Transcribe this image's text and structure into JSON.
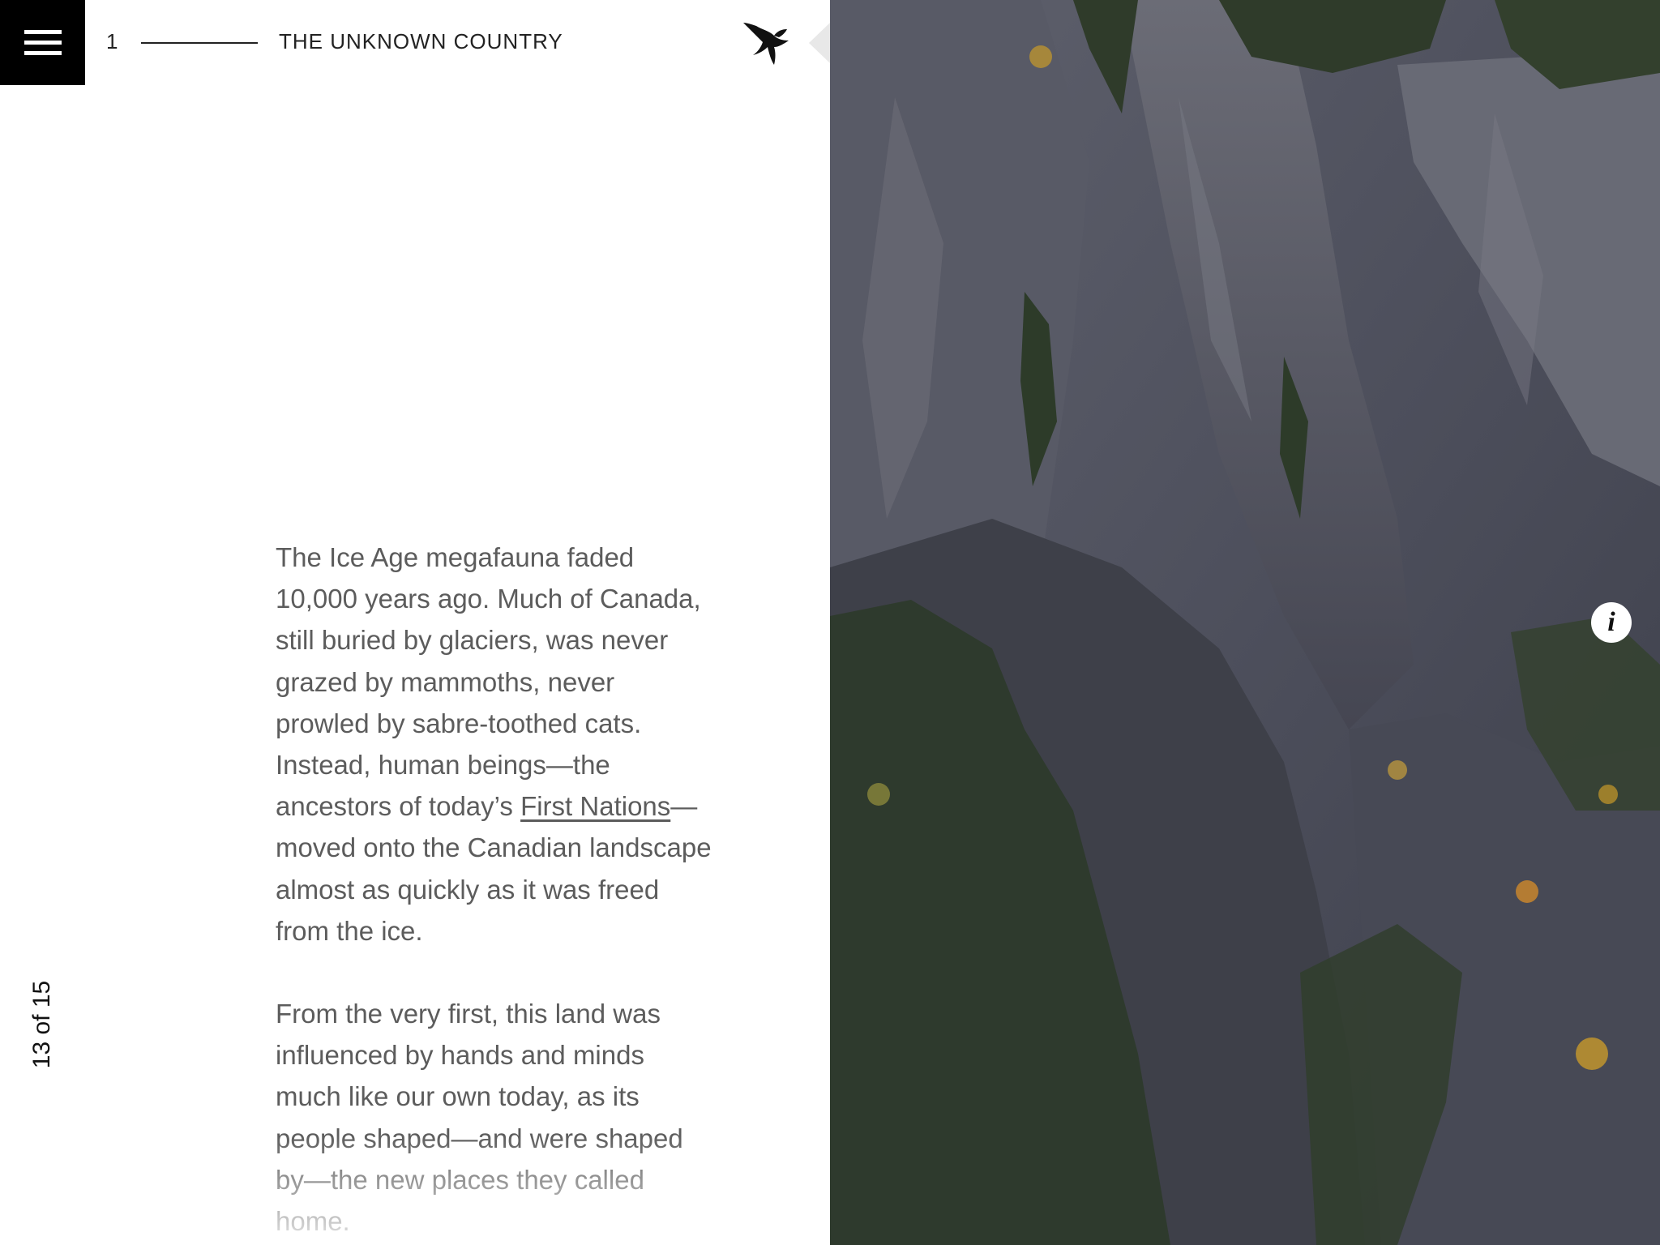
{
  "header": {
    "chapter_number": "1",
    "chapter_title": "THE UNKNOWN COUNTRY"
  },
  "icons": {
    "menu": "hamburger-menu-icon",
    "logo": "flying-bird-icon",
    "info": "info-icon"
  },
  "page_counter": "13 of 15",
  "article": {
    "paragraph1_before_link": "The Ice Age megafauna faded 10,000 years ago. Much of Canada, still buried by glaciers, was never grazed by mammoths, never prowled by sabre-toothed cats. Instead, human beings—the ancestors of today’s ",
    "paragraph1_link": "First Nations",
    "paragraph1_after_link": "—moved onto the Canadian landscape almost as quickly as it was freed from the ice.",
    "paragraph2": "From the very first, this land was influenced by hands and minds much like our own today, as its people shaped—and were shaped by—the new places they called home."
  },
  "info_button_label": "i",
  "colors": {
    "menu_background": "#000000",
    "body_text": "#5c5c5c",
    "photo_rock": "#4a4c58",
    "photo_trees": "#2f3b2a",
    "autumn_leaves": "#c89a2a"
  }
}
